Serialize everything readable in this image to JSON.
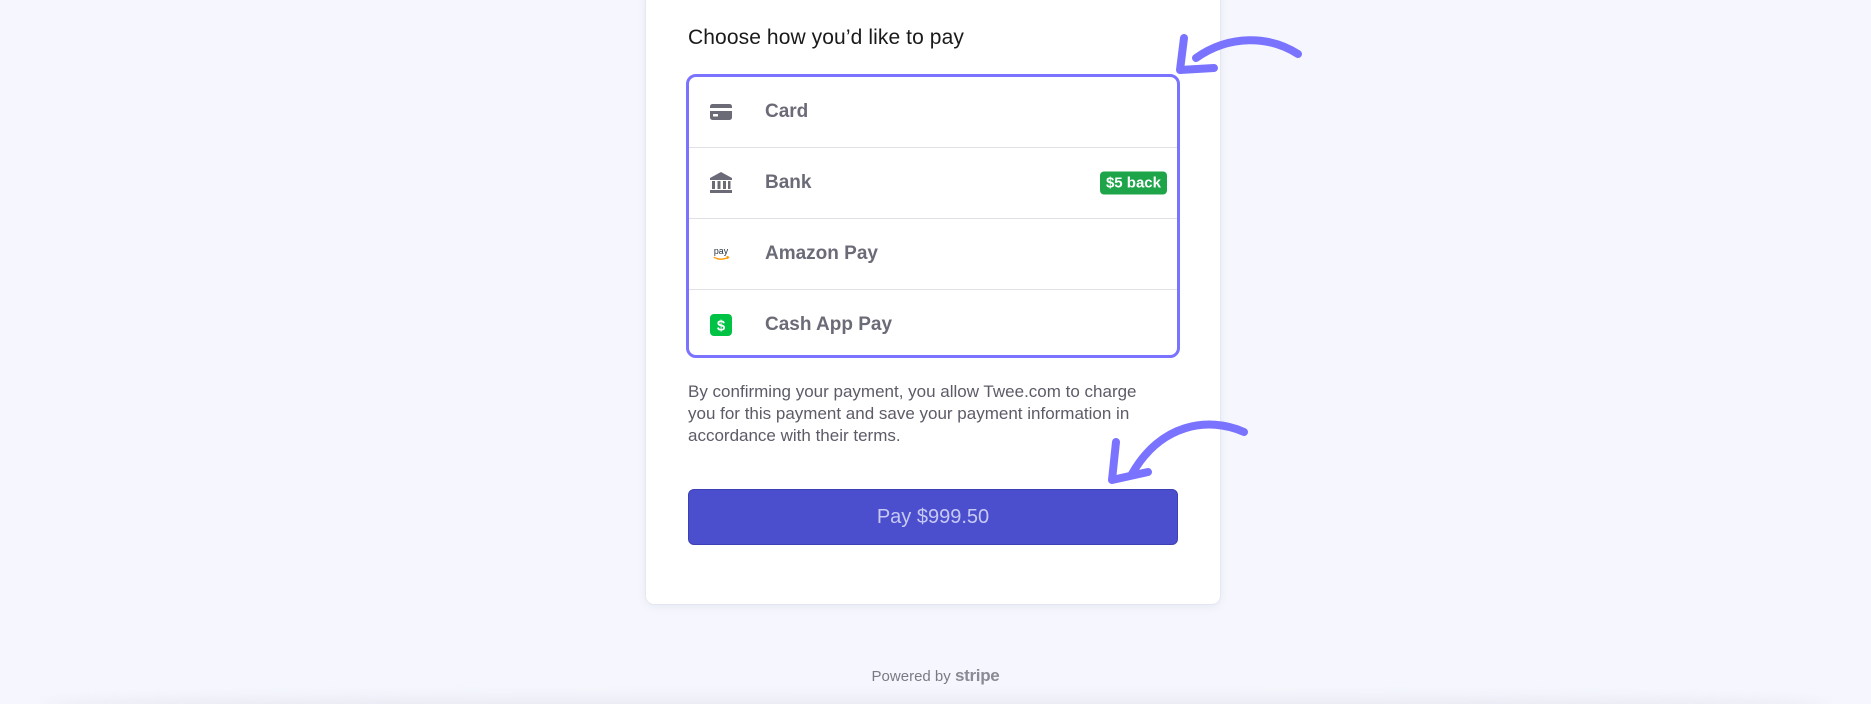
{
  "checkout": {
    "heading": "Choose how you’d like to pay",
    "payment_methods": [
      {
        "label": "Card",
        "icon": "card-icon"
      },
      {
        "label": "Bank",
        "icon": "bank-icon",
        "badge": "$5 back"
      },
      {
        "label": "Amazon Pay",
        "icon": "amazon-pay-icon",
        "icon_text": "pay"
      },
      {
        "label": "Cash App Pay",
        "icon": "cash-app-icon",
        "icon_text": "$"
      }
    ],
    "consent_text": "By confirming your payment, you allow Twee.com to charge you for this payment and save your payment information in accordance with their terms.",
    "pay_button_label": "Pay $999.50"
  },
  "footer": {
    "powered_by": "Powered by",
    "brand": "stripe"
  },
  "colors": {
    "accent_outline": "#7a73ff",
    "pay_button": "#4b4fce",
    "badge_green": "#1ea54a",
    "cash_app_green": "#00c244",
    "annotation_arrow": "#7a73ff"
  }
}
